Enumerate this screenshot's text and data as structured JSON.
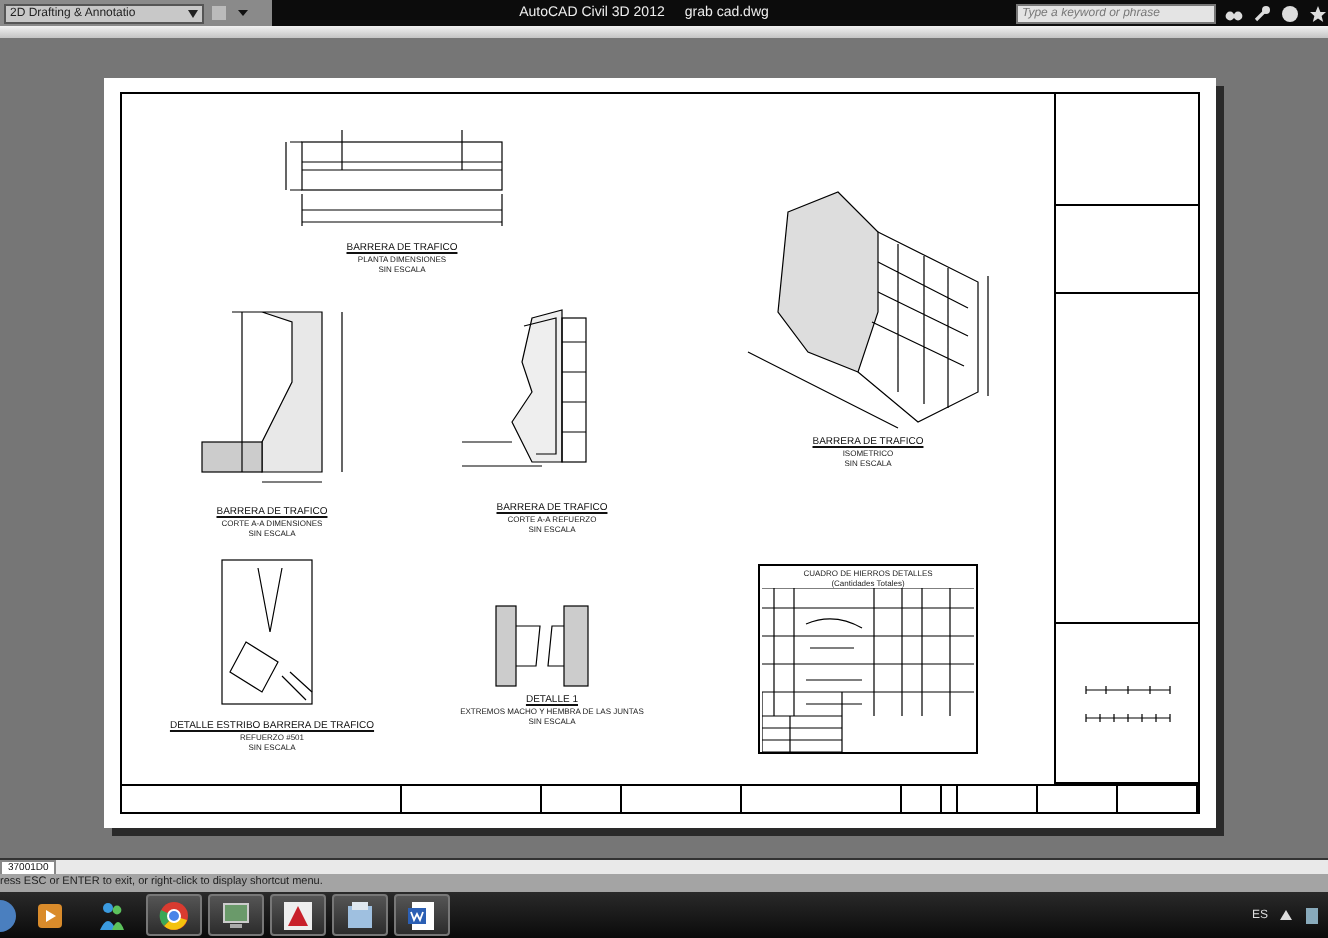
{
  "window": {
    "workspace": "2D Drafting & Annotatio",
    "title": "AutoCAD Civil 3D 2012",
    "file": "grab cad.dwg"
  },
  "search": {
    "placeholder": "Type a keyword or phrase"
  },
  "drawings": [
    {
      "kind": "plan",
      "title": "BARRERA DE TRAFICO",
      "subtitle": "PLANTA DIMENSIONES",
      "scale": "SIN ESCALA"
    },
    {
      "kind": "isometric",
      "title": "BARRERA DE TRAFICO",
      "subtitle": "ISOMETRICO",
      "scale": "SIN ESCALA"
    },
    {
      "kind": "section",
      "title": "BARRERA DE TRAFICO",
      "subtitle": "CORTE A-A DIMENSIONES",
      "scale": "SIN ESCALA"
    },
    {
      "kind": "reinforcement",
      "title": "BARRERA DE TRAFICO",
      "subtitle": "CORTE A-A REFUERZO",
      "scale": "SIN ESCALA"
    },
    {
      "kind": "stirrup",
      "title": "DETALLE ESTRIBO BARRERA DE TRAFICO",
      "subtitle": "REFUERZO #501",
      "scale": "SIN ESCALA"
    },
    {
      "kind": "joint",
      "title": "DETALLE 1",
      "subtitle": "EXTREMOS MACHO Y HEMBRA DE LAS JUNTAS",
      "scale": "SIN ESCALA"
    }
  ],
  "table": {
    "title": "CUADRO DE HIERROS DETALLES",
    "subtitle": "(Cantidades Totales)"
  },
  "layout_tab": "37001D0",
  "command_line": "ress ESC or ENTER to exit, or right-click to display shortcut menu.",
  "taskbar": {
    "apps": [
      {
        "kind": "media",
        "open": false
      },
      {
        "kind": "people",
        "open": false
      },
      {
        "kind": "browser",
        "open": true
      },
      {
        "kind": "monitor",
        "open": true
      },
      {
        "kind": "cad",
        "open": true
      },
      {
        "kind": "files",
        "open": true
      },
      {
        "kind": "document",
        "open": true
      }
    ],
    "language": "ES"
  }
}
